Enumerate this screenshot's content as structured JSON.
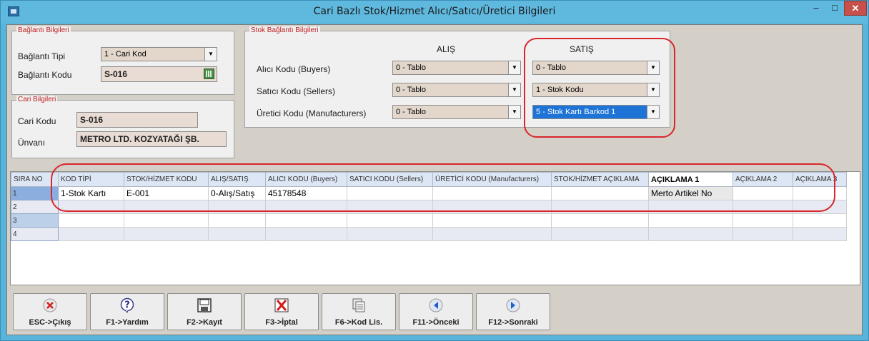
{
  "window": {
    "title": "Cari Bazlı Stok/Hizmet Alıcı/Satıcı/Üretici Bilgileri",
    "min": "–",
    "max": "□",
    "close": "✕"
  },
  "baglanti": {
    "legend": "Bağlantı Bilgileri",
    "tip_label": "Bağlantı Tipi",
    "tip_value": "1 - Cari Kod",
    "kod_label": "Bağlantı Kodu",
    "kod_value": "S-016"
  },
  "cari": {
    "legend": "Cari Bilgileri",
    "kod_label": "Cari Kodu",
    "kod_value": "S-016",
    "unvan_label": "Ünvanı",
    "unvan_value": "METRO LTD. KOZYATAĞI ŞB."
  },
  "stok": {
    "legend": "Stok Bağlantı Bilgileri",
    "alis_header": "ALIŞ",
    "satis_header": "SATIŞ",
    "rows": [
      {
        "label": "Alıcı Kodu (Buyers)",
        "alis": "0 - Tablo",
        "satis": "0 - Tablo"
      },
      {
        "label": "Satıcı Kodu (Sellers)",
        "alis": "0 - Tablo",
        "satis": "1 - Stok Kodu"
      },
      {
        "label": "Üretici Kodu (Manufacturers)",
        "alis": "0 - Tablo",
        "satis": "5 - Stok Kartı Barkod 1"
      }
    ]
  },
  "table": {
    "columns": [
      "SIRA NO",
      "KOD TİPİ",
      "STOK/HİZMET KODU",
      "ALIŞ/SATIŞ",
      "ALICI KODU (Buyers)",
      "SATICI KODU (Sellers)",
      "ÜRETİCİ KODU (Manufacturers)",
      "STOK/HİZMET AÇIKLAMA",
      "AÇIKLAMA 1",
      "AÇIKLAMA 2",
      "AÇIKLAMA 3"
    ],
    "rows": [
      [
        "1",
        "1-Stok Kartı",
        "E-001",
        "0-Alış/Satış",
        "45178548",
        "",
        "",
        "",
        "Merto Artikel No",
        "",
        ""
      ],
      [
        "2",
        "",
        "",
        "",
        "",
        "",
        "",
        "",
        "",
        "",
        ""
      ],
      [
        "3",
        "",
        "",
        "",
        "",
        "",
        "",
        "",
        "",
        "",
        ""
      ],
      [
        "4",
        "",
        "",
        "",
        "",
        "",
        "",
        "",
        "",
        "",
        ""
      ]
    ]
  },
  "buttons": [
    {
      "label": "ESC->Çıkış",
      "icon": "cancel-circle-icon"
    },
    {
      "label": "F1->Yardım",
      "icon": "help-icon"
    },
    {
      "label": "F2->Kayıt",
      "icon": "save-icon"
    },
    {
      "label": "F3->İptal",
      "icon": "delete-icon"
    },
    {
      "label": "F6->Kod Lis.",
      "icon": "list-icon"
    },
    {
      "label": "F11->Önceki",
      "icon": "arrow-left-icon"
    },
    {
      "label": "F12->Sonraki",
      "icon": "arrow-right-icon"
    }
  ],
  "colors": {
    "title_bar": "#5fb8dd",
    "annotation": "#d9262c",
    "selected": "#1e74d6"
  }
}
